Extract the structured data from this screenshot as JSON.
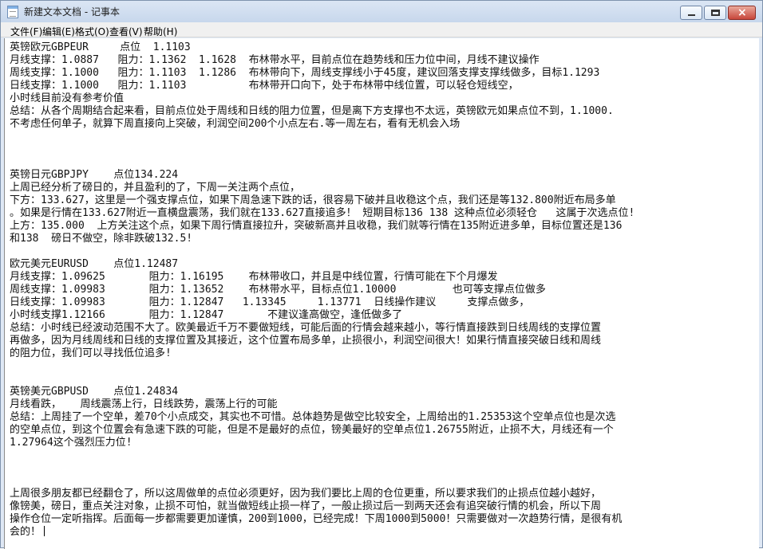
{
  "window": {
    "title": "新建文本文档 - 记事本"
  },
  "menu": [
    "文件(F)",
    "编辑(E)",
    "格式(O)",
    "查看(V)",
    "帮助(H)"
  ],
  "document": {
    "lines": [
      "英镑欧元GBPEUR     点位  1.1103",
      "月线支撑：1.0887   阻力：1.1362  1.1628  布林带水平，目前点位在趋势线和压力位中间，月线不建议操作",
      "周线支撑：1.1000   阻力：1.1103  1.1286  布林带向下，周线支撑线小于45度，建议回落支撑支撑线做多，目标1.1293",
      "日线支撑：1.1000   阻力：1.1103          布林带开口向下，处于布林带中线位置，可以轻仓短线空，",
      "小时线目前没有参考价值",
      "总结：从各个周期结合起来看，目前点位处于周线和日线的阻力位置，但是离下方支撑也不太远，英镑欧元如果点位不到，1.1000.",
      "不考虑任何单子，就算下周直接向上突破，利润空间200个小点左右.等一周左右，看有无机会入场",
      "",
      "",
      "",
      "英镑日元GBPJPY    点位134.224",
      "上周已经分析了磅日的，并且盈利的了，下周一关注两个点位，",
      "下方：133.627，这里是一个强支撑点位，如果下周急速下跌的话，很容易下破并且收稳这个点，我们还是等132.800附近布局多单",
      "。如果是行情在133.627附近一直横盘震荡，我们就在133.627直接追多！ 短期目标136 138 这种点位必须轻仓   这属于次选点位!",
      "上方：135.000  上方关注这个点，如果下周行情直接拉升，突破新高并且收稳，我们就等行情在135附近进多单，目标位置还是136",
      "和138  磅日不做空，除非跌破132.5!",
      "",
      "欧元美元EURUSD    点位1.12487",
      "月线支撑：1.09625       阻力：1.16195    布林带收口，并且是中线位置，行情可能在下个月爆发",
      "周线支撑：1.09983       阻力：1.13652    布林带水平，目标点位1.10000         也可等支撑点位做多",
      "日线支撑：1.09983       阻力：1.12847   1.13345     1.13771  日线操作建议     支撑点做多，",
      "小时线支撑1.12166       阻力：1.12847       不建议逢高做空，逢低做多了",
      "总结：小时线已经波动范围不大了。欧美最近千万不要做短线，可能后面的行情会越来越小，等行情直接跌到日线周线的支撑位置",
      "再做多，因为月线周线和日线的支撑位置及其接近，这个位置布局多单，止损很小，利润空间很大！如果行情直接突破日线和周线",
      "的阻力位，我们可以寻找低位追多!",
      "",
      "",
      "英镑美元GBPUSD    点位1.24834",
      "月线看跌，   周线震荡上行，日线跌势，震荡上行的可能",
      "总结：上周挂了一个空单，差70个小点成交，其实也不可惜。总体趋势是做空比较安全，上周给出的1.25353这个空单点位也是次选",
      "的空单点位，到这个位置会有急速下跌的可能，但是不是最好的点位，镑美最好的空单点位1.26755附近，止损不大，月线还有一个",
      "1.27964这个强烈压力位!",
      "",
      "",
      "",
      "上周很多朋友都已经翻仓了，所以这周做单的点位必须更好，因为我们要比上周的仓位更重，所以要求我们的止损点位越小越好，",
      "像镑美，磅日，重点关注对象，止损不可怕，就当做短线止损一样了，一般止损过后一到两天还会有追突破行情的机会，所以下周",
      "操作仓位一定听指挥。后面每一步都需要更加谨慎，200到1000，已经完成！下周1000到5000！只需要做对一次趋势行情，是很有机",
      "会的！"
    ]
  }
}
